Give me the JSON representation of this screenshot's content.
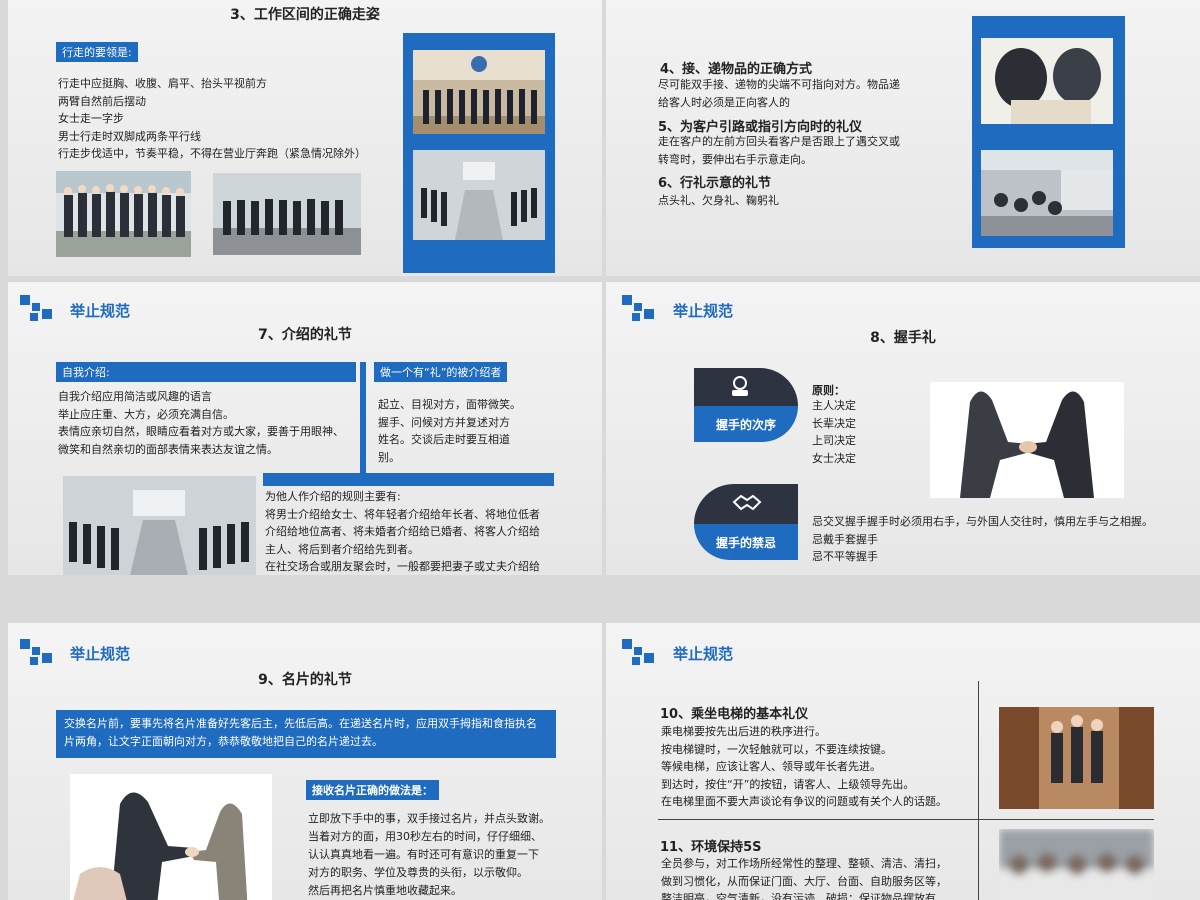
{
  "header_label": "举止规范",
  "s1": {
    "title": "3、工作区间的正确走姿",
    "label": "行走的要领是:",
    "lines": "行走中应挺胸、收腹、肩平、抬头平视前方\n两臂自然前后摆动\n女士走一字步\n男士行走时双脚成两条平行线\n行走步伐适中，节奏平稳，不得在营业厅奔跑（紧急情况除外）"
  },
  "s2": {
    "h4": "4、接、递物品的正确方式",
    "t4": "尽可能双手接、递物的尖端不可指向对方。物品递\n给客人时必须是正向客人的",
    "h5": "5、为客户引路或指引方向时的礼仪",
    "t5": "走在客户的左前方回头看客户是否跟上了遇交叉或\n转弯时，要伸出右手示意走向。",
    "h6": "6、行礼示意的礼节",
    "t6": "点头礼、欠身礼、鞠躬礼"
  },
  "s3": {
    "title": "7、介绍的礼节",
    "self_label": "自我介绍:",
    "self_text": "自我介绍应用简洁或风趣的语言\n举止应庄重、大方，必须充满自信。\n表情应亲切自然，眼睛应看着对方或大家，要善于用眼神、\n微笑和自然亲切的面部表情来表达友谊之情。",
    "intro_label": "做一个有“礼”的被介绍者",
    "intro_text": "起立、目视对方，面带微笑。\n握手、问候对方并复述对方\n姓名。交谈后走时要互相道\n别。",
    "rules_text": "为他人作介绍的规则主要有:\n将男士介绍给女士、将年轻者介绍给年长者、将地位低者\n介绍给地位高者、将未婚者介绍给已婚者、将客人介绍给\n主人、将后到者介绍给先到者。\n在社交场合或朋友聚会时，一般都要把妻子或丈夫介绍给\n朋友认识。"
  },
  "s4": {
    "title": "8、握手礼",
    "order_label": "握手的次序",
    "order_head": "原则：",
    "order_text": "主人决定\n长辈决定\n上司决定\n女士决定",
    "ban_label": "握手的禁忌",
    "ban_text": "忌交叉握手握手时必须用右手，与外国人交往时，慎用左手与之相握。\n忌戴手套握手\n忌不平等握手"
  },
  "s5": {
    "title": "9、名片的礼节",
    "banner": "交换名片前，要事先将名片准备好先客后主，先低后高。在递送名片时，应用双手拇指和食指执名\n片两角，让文字正面朝向对方，恭恭敬敬地把自己的名片递过去。",
    "recv_label": "接收名片正确的做法是：",
    "recv_text": "立即放下手中的事，双手接过名片，并点头致谢。\n当着对方的面，用30秒左右的时间，仔仔细细、\n认认真真地看一遍。有时还可有意识的重复一下\n对方的职务、学位及尊贵的头衔，以示敬仰。\n然后再把名片慎重地收藏起来。"
  },
  "s6": {
    "h10": "10、乘坐电梯的基本礼仪",
    "t10": "乘电梯要按先出后进的秩序进行。\n按电梯键时，一次轻触就可以，不要连续按键。\n等候电梯，应该让客人、领导或年长者先进。\n到达时，按住“开”的按钮，请客人、上级领导先出。\n在电梯里面不要大声谈论有争议的问题或有关个人的话题。",
    "h11": "11、环境保持5S",
    "t11": "全员参与，对工作场所经常性的整理、整顿、清洁、清扫，\n做到习惯化，从而保证门面、大厅、台面、自助服务区等，\n整洁明亮，空气清新，没有污迹、破损；保证物品摆放有"
  }
}
